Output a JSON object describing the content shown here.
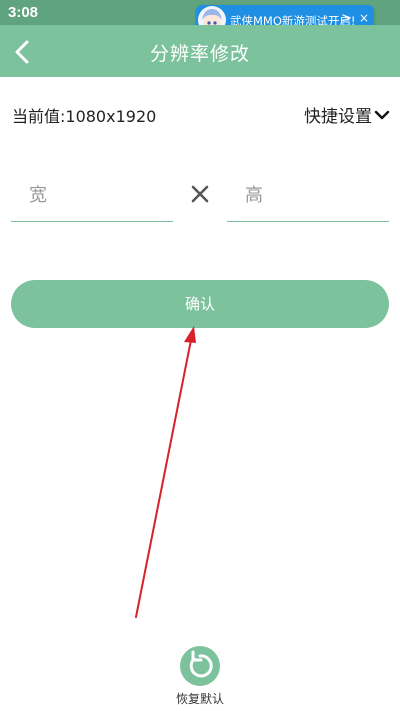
{
  "status_bar": {
    "time": "3:08",
    "notification": {
      "text": "武侠MMO新游测试开启!",
      "next_glyph": ">",
      "close_glyph": "×"
    }
  },
  "header": {
    "title": "分辨率修改",
    "back_icon": "chevron-left-icon"
  },
  "resolution": {
    "current_label": "当前值:1080x1920",
    "quick_settings_label": "快捷设置",
    "width_placeholder": "宽",
    "height_placeholder": "高",
    "width_value": "",
    "height_value": ""
  },
  "actions": {
    "confirm_label": "确认",
    "restore_label": "恢复默认"
  },
  "colors": {
    "accent": "#7cc29c",
    "status_bar": "#5fa37f",
    "annotation_arrow": "#d9212c"
  }
}
